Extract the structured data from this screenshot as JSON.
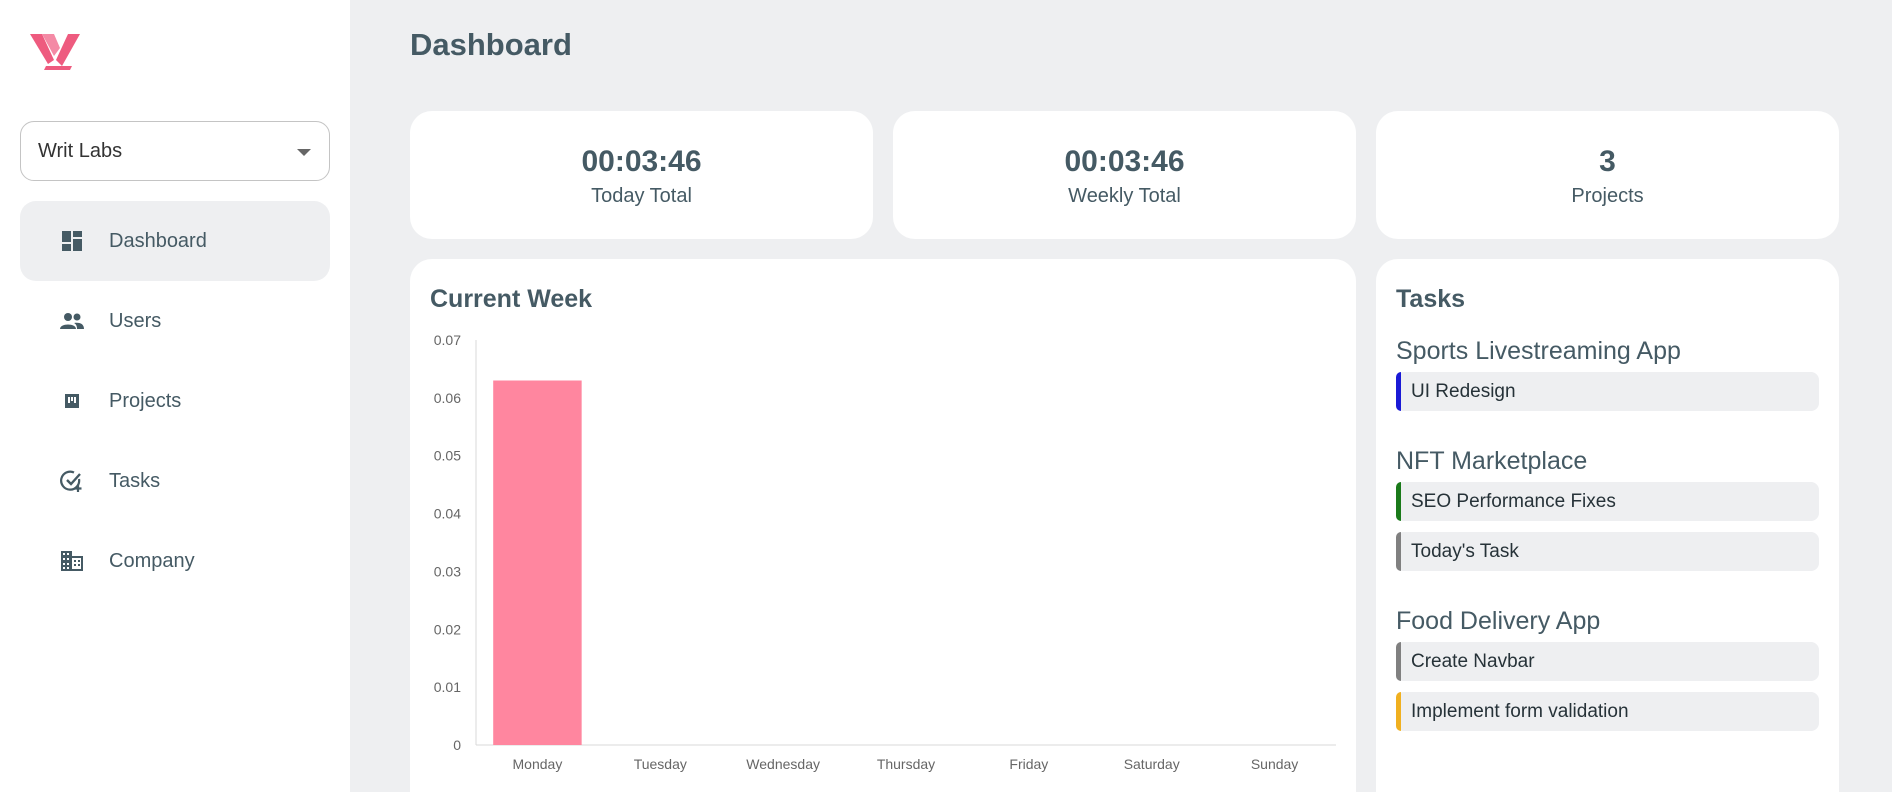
{
  "sidebar": {
    "org_select": "Writ Labs",
    "items": [
      {
        "label": "Dashboard",
        "icon": "dashboard-icon",
        "active": true
      },
      {
        "label": "Users",
        "icon": "users-icon"
      },
      {
        "label": "Projects",
        "icon": "projects-icon"
      },
      {
        "label": "Tasks",
        "icon": "task-check-icon"
      },
      {
        "label": "Company",
        "icon": "company-icon"
      }
    ]
  },
  "header": {
    "title": "Dashboard"
  },
  "stats": [
    {
      "value": "00:03:46",
      "label": "Today Total"
    },
    {
      "value": "00:03:46",
      "label": "Weekly Total"
    },
    {
      "value": "3",
      "label": "Projects"
    }
  ],
  "chart": {
    "title": "Current Week"
  },
  "chart_data": {
    "type": "bar",
    "title": "Current Week",
    "categories": [
      "Monday",
      "Tuesday",
      "Wednesday",
      "Thursday",
      "Friday",
      "Saturday",
      "Sunday"
    ],
    "values": [
      0.063,
      0,
      0,
      0,
      0,
      0,
      0
    ],
    "ylim": [
      0,
      0.07
    ],
    "yticks": [
      "0",
      "0.01",
      "0.02",
      "0.03",
      "0.04",
      "0.05",
      "0.06",
      "0.07"
    ],
    "xlabel": "",
    "ylabel": "",
    "grid": false,
    "bar_color": "#ff869f"
  },
  "tasks": {
    "title": "Tasks",
    "groups": [
      {
        "name": "Sports Livestreaming App",
        "items": [
          {
            "label": "UI Redesign",
            "color": "#1a1ad6"
          }
        ]
      },
      {
        "name": "NFT Marketplace",
        "items": [
          {
            "label": "SEO Performance Fixes",
            "color": "#1a7a1a"
          },
          {
            "label": "Today's Task",
            "color": "#808080"
          }
        ]
      },
      {
        "name": "Food Delivery App",
        "items": [
          {
            "label": "Create Navbar",
            "color": "#808080"
          },
          {
            "label": "Implement form validation",
            "color": "#f0b020"
          }
        ]
      }
    ]
  },
  "colors": {
    "brand": "#ee5b7f",
    "bar": "#ff869f"
  }
}
